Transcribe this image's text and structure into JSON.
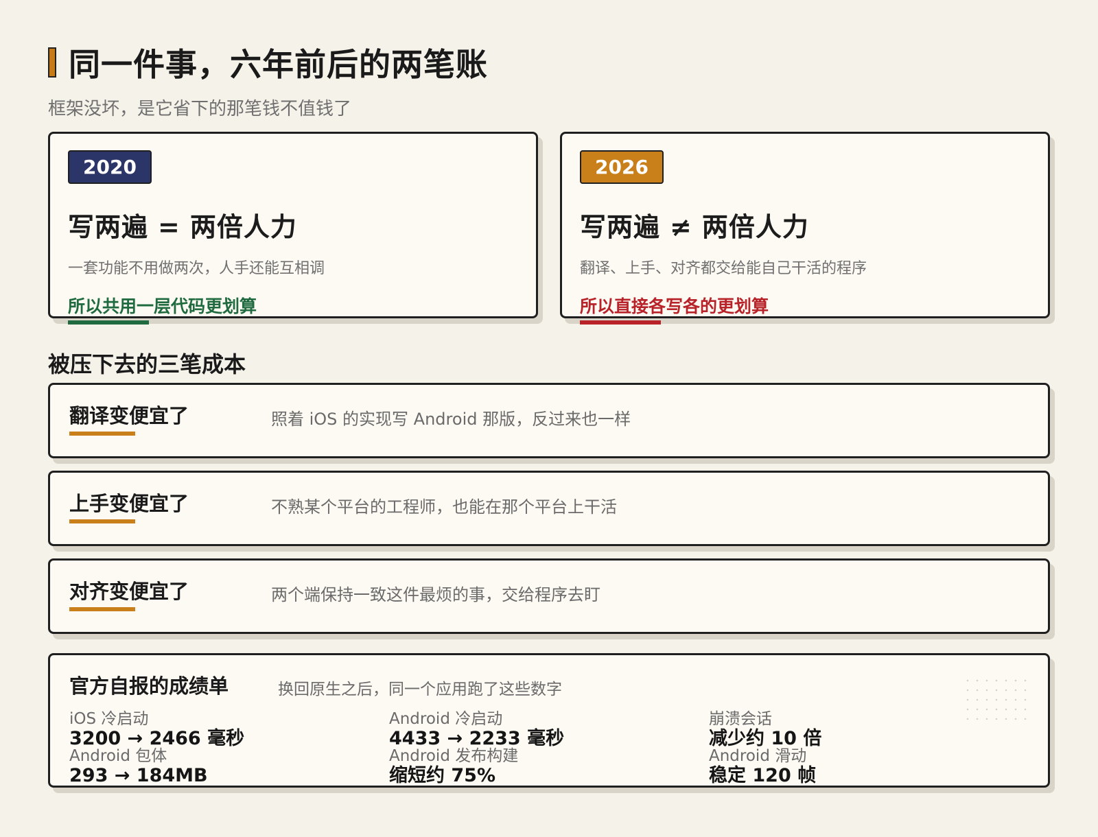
{
  "header": {
    "title": "同一件事，六年前后的两笔账",
    "subtitle": "框架没坏，是它省下的那笔钱不值钱了"
  },
  "compare": [
    {
      "year": "2020",
      "equation_left": "写两遍",
      "operator": "=",
      "equation_right": "两倍人力",
      "description": "一套功能不用做两次，人手还能互相调",
      "conclusion": "所以共用一层代码更划算"
    },
    {
      "year": "2026",
      "equation_left": "写两遍",
      "operator": "≠",
      "equation_right": "两倍人力",
      "description": "翻译、上手、对齐都交给能自己干活的程序",
      "conclusion": "所以直接各写各的更划算"
    }
  ],
  "costs_section": {
    "title": "被压下去的三笔成本",
    "items": [
      {
        "label": "翻译变便宜了",
        "description": "照着 iOS 的实现写 Android 那版，反过来也一样"
      },
      {
        "label": "上手变便宜了",
        "description": "不熟某个平台的工程师，也能在那个平台上干活"
      },
      {
        "label": "对齐变便宜了",
        "description": "两个端保持一致这件最烦的事，交给程序去盯"
      }
    ]
  },
  "report": {
    "title": "官方自报的成绩单",
    "subtitle": "换回原生之后，同一个应用跑了这些数字",
    "stats": [
      {
        "label": "iOS 冷启动",
        "value": "3200 → 2466 毫秒"
      },
      {
        "label": "Android 冷启动",
        "value": "4433 → 2233 毫秒"
      },
      {
        "label": "崩溃会话",
        "value": "减少约 10 倍"
      },
      {
        "label": "Android 包体",
        "value": "293 → 184MB"
      },
      {
        "label": "Android 发布构建",
        "value": "缩短约 75%"
      },
      {
        "label": "Android 滑动",
        "value": "稳定 120 帧"
      }
    ]
  },
  "colors": {
    "accent_amber": "#c9801a",
    "badge_navy": "#2c3568",
    "positive_green": "#1f6a3e",
    "negative_red": "#b8232a",
    "background": "#f5f2ea"
  }
}
